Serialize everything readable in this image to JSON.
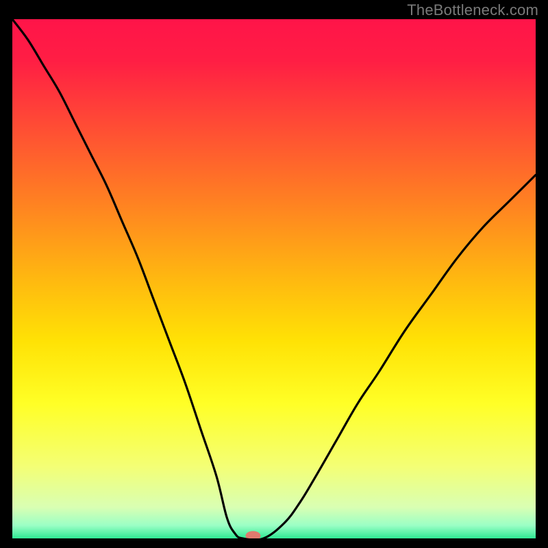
{
  "attribution": "TheBottleneck.com",
  "chart_data": {
    "type": "line",
    "title": "",
    "xlabel": "",
    "ylabel": "",
    "xlim": [
      0,
      100
    ],
    "ylim": [
      0,
      100
    ],
    "background": {
      "kind": "vertical-gradient",
      "description": "red at top through orange and yellow to green at bottom",
      "stops": [
        {
          "pos": 0.0,
          "color": "#FF1449"
        },
        {
          "pos": 0.08,
          "color": "#FF1E44"
        },
        {
          "pos": 0.2,
          "color": "#FF4A35"
        },
        {
          "pos": 0.35,
          "color": "#FF8022"
        },
        {
          "pos": 0.5,
          "color": "#FFB810"
        },
        {
          "pos": 0.62,
          "color": "#FFE205"
        },
        {
          "pos": 0.74,
          "color": "#FFFF26"
        },
        {
          "pos": 0.86,
          "color": "#F4FF74"
        },
        {
          "pos": 0.94,
          "color": "#D9FFB3"
        },
        {
          "pos": 0.975,
          "color": "#9BFFC5"
        },
        {
          "pos": 1.0,
          "color": "#2FE994"
        }
      ]
    },
    "series": [
      {
        "name": "curve",
        "x": [
          0,
          3,
          6,
          9,
          12,
          15,
          18,
          21,
          24,
          27,
          30,
          33,
          36,
          39,
          41,
          42.5,
          44,
          48,
          52,
          55,
          58,
          62,
          66,
          70,
          75,
          80,
          85,
          90,
          95,
          100
        ],
        "values": [
          100,
          96,
          91,
          86,
          80,
          74,
          68,
          61,
          54,
          46,
          38,
          30,
          21,
          12,
          4,
          1,
          0,
          0,
          3,
          7,
          12,
          19,
          26,
          32,
          40,
          47,
          54,
          60,
          65,
          70
        ]
      }
    ],
    "marker": {
      "x": 46,
      "y": 0.5,
      "color": "#E07A6E",
      "rx": 11,
      "ry": 7
    }
  },
  "colors": {
    "frame": "#000000",
    "curve": "#000000",
    "attribution": "#7a7a7a"
  }
}
